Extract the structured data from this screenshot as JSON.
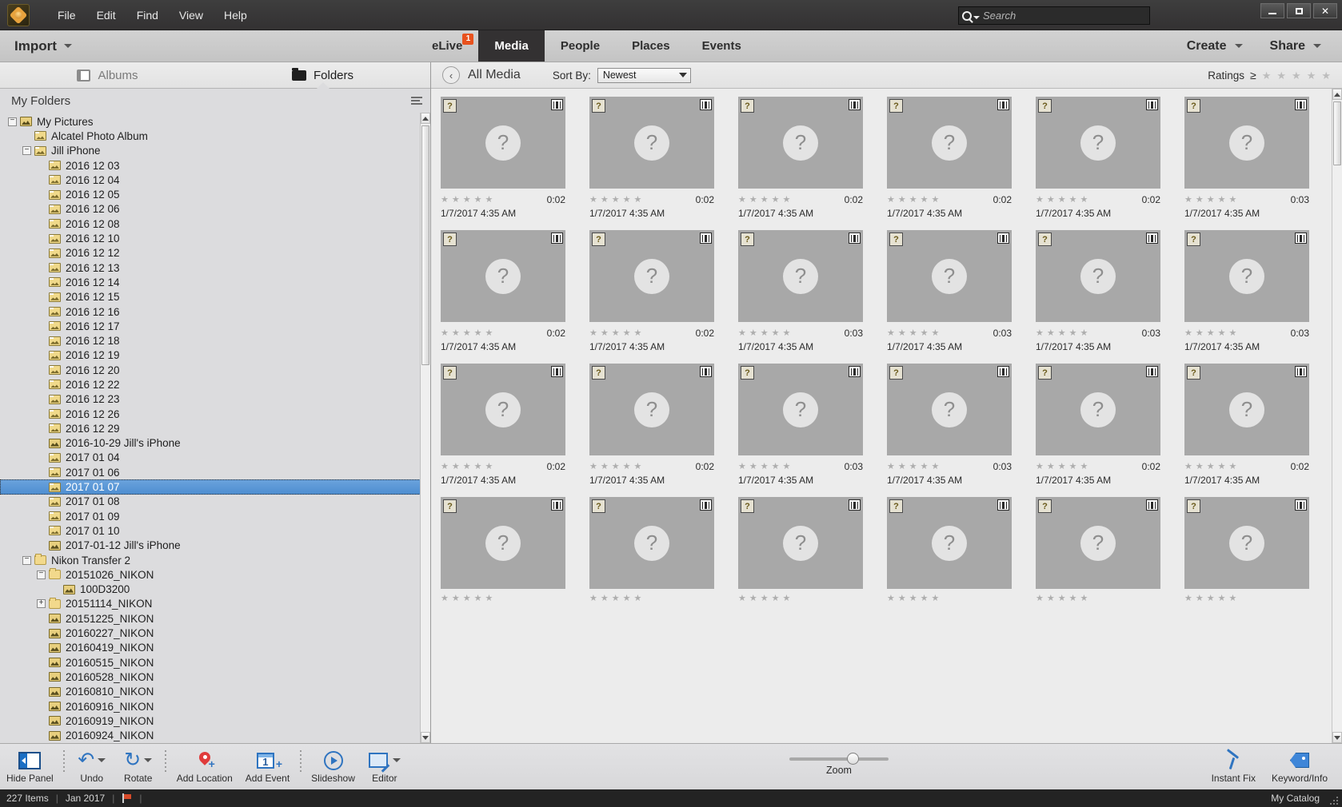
{
  "titlebar": {
    "menus": [
      "File",
      "Edit",
      "Find",
      "View",
      "Help"
    ],
    "search_placeholder": "Search",
    "search_value": "",
    "minimize_label": "",
    "maximize_label": "",
    "close_label": "✕"
  },
  "navbar": {
    "import_label": "Import",
    "tabs": [
      {
        "label": "eLive",
        "badge": "1",
        "active": false
      },
      {
        "label": "Media",
        "badge": "",
        "active": true
      },
      {
        "label": "People",
        "badge": "",
        "active": false
      },
      {
        "label": "Places",
        "badge": "",
        "active": false
      },
      {
        "label": "Events",
        "badge": "",
        "active": false
      }
    ],
    "create_label": "Create",
    "share_label": "Share"
  },
  "sidebar": {
    "tabs": [
      {
        "label": "Albums",
        "icon": "album-icon",
        "active": false
      },
      {
        "label": "Folders",
        "icon": "folder-icon",
        "active": true
      }
    ],
    "header": "My Folders",
    "tree": [
      {
        "label": "My Pictures",
        "depth": 0,
        "twist": "−",
        "icon": "mypictures",
        "selected": false
      },
      {
        "label": "Alcatel Photo Album",
        "depth": 1,
        "twist": "",
        "icon": "picture",
        "selected": false
      },
      {
        "label": "Jill iPhone",
        "depth": 1,
        "twist": "−",
        "icon": "picture",
        "selected": false
      },
      {
        "label": "2016 12 03",
        "depth": 2,
        "twist": "",
        "icon": "picture",
        "selected": false
      },
      {
        "label": "2016 12 04",
        "depth": 2,
        "twist": "",
        "icon": "picture",
        "selected": false
      },
      {
        "label": "2016 12 05",
        "depth": 2,
        "twist": "",
        "icon": "picture",
        "selected": false
      },
      {
        "label": "2016 12 06",
        "depth": 2,
        "twist": "",
        "icon": "picture",
        "selected": false
      },
      {
        "label": "2016 12 08",
        "depth": 2,
        "twist": "",
        "icon": "picture",
        "selected": false
      },
      {
        "label": "2016 12 10",
        "depth": 2,
        "twist": "",
        "icon": "picture",
        "selected": false
      },
      {
        "label": "2016 12 12",
        "depth": 2,
        "twist": "",
        "icon": "picture",
        "selected": false
      },
      {
        "label": "2016 12 13",
        "depth": 2,
        "twist": "",
        "icon": "picture",
        "selected": false
      },
      {
        "label": "2016 12 14",
        "depth": 2,
        "twist": "",
        "icon": "picture",
        "selected": false
      },
      {
        "label": "2016 12 15",
        "depth": 2,
        "twist": "",
        "icon": "picture",
        "selected": false
      },
      {
        "label": "2016 12 16",
        "depth": 2,
        "twist": "",
        "icon": "picture",
        "selected": false
      },
      {
        "label": "2016 12 17",
        "depth": 2,
        "twist": "",
        "icon": "picture",
        "selected": false
      },
      {
        "label": "2016 12 18",
        "depth": 2,
        "twist": "",
        "icon": "picture",
        "selected": false
      },
      {
        "label": "2016 12 19",
        "depth": 2,
        "twist": "",
        "icon": "picture",
        "selected": false
      },
      {
        "label": "2016 12 20",
        "depth": 2,
        "twist": "",
        "icon": "picture",
        "selected": false
      },
      {
        "label": "2016 12 22",
        "depth": 2,
        "twist": "",
        "icon": "picture",
        "selected": false
      },
      {
        "label": "2016 12 23",
        "depth": 2,
        "twist": "",
        "icon": "picture",
        "selected": false
      },
      {
        "label": "2016 12 26",
        "depth": 2,
        "twist": "",
        "icon": "picture",
        "selected": false
      },
      {
        "label": "2016 12 29",
        "depth": 2,
        "twist": "",
        "icon": "picture",
        "selected": false
      },
      {
        "label": "2016-10-29 Jill's iPhone",
        "depth": 2,
        "twist": "",
        "icon": "picture-filled",
        "selected": false
      },
      {
        "label": "2017 01 04",
        "depth": 2,
        "twist": "",
        "icon": "picture",
        "selected": false
      },
      {
        "label": "2017 01 06",
        "depth": 2,
        "twist": "",
        "icon": "picture",
        "selected": false
      },
      {
        "label": "2017 01 07",
        "depth": 2,
        "twist": "",
        "icon": "picture",
        "selected": true
      },
      {
        "label": "2017 01 08",
        "depth": 2,
        "twist": "",
        "icon": "picture",
        "selected": false
      },
      {
        "label": "2017 01 09",
        "depth": 2,
        "twist": "",
        "icon": "picture",
        "selected": false
      },
      {
        "label": "2017 01 10",
        "depth": 2,
        "twist": "",
        "icon": "picture",
        "selected": false
      },
      {
        "label": "2017-01-12 Jill's iPhone",
        "depth": 2,
        "twist": "",
        "icon": "picture-filled",
        "selected": false
      },
      {
        "label": "Nikon Transfer 2",
        "depth": 1,
        "twist": "−",
        "icon": "folder",
        "selected": false
      },
      {
        "label": "20151026_NIKON",
        "depth": 2,
        "twist": "−",
        "icon": "folder",
        "selected": false
      },
      {
        "label": "100D3200",
        "depth": 3,
        "twist": "",
        "icon": "picture-filled",
        "selected": false
      },
      {
        "label": "20151114_NIKON",
        "depth": 2,
        "twist": "+",
        "icon": "folder",
        "selected": false
      },
      {
        "label": "20151225_NIKON",
        "depth": 2,
        "twist": "",
        "icon": "picture-filled",
        "selected": false
      },
      {
        "label": "20160227_NIKON",
        "depth": 2,
        "twist": "",
        "icon": "picture-filled",
        "selected": false
      },
      {
        "label": "20160419_NIKON",
        "depth": 2,
        "twist": "",
        "icon": "picture-filled",
        "selected": false
      },
      {
        "label": "20160515_NIKON",
        "depth": 2,
        "twist": "",
        "icon": "picture-filled",
        "selected": false
      },
      {
        "label": "20160528_NIKON",
        "depth": 2,
        "twist": "",
        "icon": "picture-filled",
        "selected": false
      },
      {
        "label": "20160810_NIKON",
        "depth": 2,
        "twist": "",
        "icon": "picture-filled",
        "selected": false
      },
      {
        "label": "20160916_NIKON",
        "depth": 2,
        "twist": "",
        "icon": "picture-filled",
        "selected": false
      },
      {
        "label": "20160919_NIKON",
        "depth": 2,
        "twist": "",
        "icon": "picture-filled",
        "selected": false
      },
      {
        "label": "20160924_NIKON",
        "depth": 2,
        "twist": "",
        "icon": "picture-filled",
        "selected": false
      }
    ]
  },
  "content": {
    "back_glyph": "‹",
    "title": "All Media",
    "sort_label": "Sort By:",
    "sort_value": "Newest",
    "ratings_label": "Ratings",
    "ratings_ge": "≥",
    "ratings_stars": 5,
    "ratings_filled": 0,
    "media": [
      {
        "duration": "0:02",
        "date": "1/7/2017 4:35 AM",
        "rating": 0
      },
      {
        "duration": "0:02",
        "date": "1/7/2017 4:35 AM",
        "rating": 0
      },
      {
        "duration": "0:02",
        "date": "1/7/2017 4:35 AM",
        "rating": 0
      },
      {
        "duration": "0:02",
        "date": "1/7/2017 4:35 AM",
        "rating": 0
      },
      {
        "duration": "0:02",
        "date": "1/7/2017 4:35 AM",
        "rating": 0
      },
      {
        "duration": "0:03",
        "date": "1/7/2017 4:35 AM",
        "rating": 0
      },
      {
        "duration": "0:02",
        "date": "1/7/2017 4:35 AM",
        "rating": 0
      },
      {
        "duration": "0:02",
        "date": "1/7/2017 4:35 AM",
        "rating": 0
      },
      {
        "duration": "0:03",
        "date": "1/7/2017 4:35 AM",
        "rating": 0
      },
      {
        "duration": "0:03",
        "date": "1/7/2017 4:35 AM",
        "rating": 0
      },
      {
        "duration": "0:03",
        "date": "1/7/2017 4:35 AM",
        "rating": 0
      },
      {
        "duration": "0:03",
        "date": "1/7/2017 4:35 AM",
        "rating": 0
      },
      {
        "duration": "0:02",
        "date": "1/7/2017 4:35 AM",
        "rating": 0
      },
      {
        "duration": "0:02",
        "date": "1/7/2017 4:35 AM",
        "rating": 0
      },
      {
        "duration": "0:03",
        "date": "1/7/2017 4:35 AM",
        "rating": 0
      },
      {
        "duration": "0:03",
        "date": "1/7/2017 4:35 AM",
        "rating": 0
      },
      {
        "duration": "0:02",
        "date": "1/7/2017 4:35 AM",
        "rating": 0
      },
      {
        "duration": "0:02",
        "date": "1/7/2017 4:35 AM",
        "rating": 0
      },
      {
        "duration": "",
        "date": "",
        "rating": 0
      },
      {
        "duration": "",
        "date": "",
        "rating": 0
      },
      {
        "duration": "",
        "date": "",
        "rating": 0
      },
      {
        "duration": "",
        "date": "",
        "rating": 0
      },
      {
        "duration": "",
        "date": "",
        "rating": 0
      },
      {
        "duration": "",
        "date": "",
        "rating": 0
      }
    ]
  },
  "bottombar": {
    "tools": [
      {
        "label": "Hide Panel",
        "icon": "hide-panel-icon"
      },
      {
        "label": "Undo",
        "icon": "undo-icon"
      },
      {
        "label": "Rotate",
        "icon": "rotate-icon"
      },
      {
        "label": "Add Location",
        "icon": "add-location-icon"
      },
      {
        "label": "Add Event",
        "icon": "add-event-icon"
      },
      {
        "label": "Slideshow",
        "icon": "slideshow-icon"
      },
      {
        "label": "Editor",
        "icon": "editor-icon"
      }
    ],
    "add_event_number": "1",
    "zoom_label": "Zoom",
    "zoom_value": 58,
    "right_tools": [
      {
        "label": "Instant Fix",
        "icon": "instant-fix-icon"
      },
      {
        "label": "Keyword/Info",
        "icon": "keyword-tag-icon"
      }
    ]
  },
  "statusbar": {
    "items_count": "227 Items",
    "date_range": "Jan 2017",
    "catalog": "My Catalog"
  }
}
